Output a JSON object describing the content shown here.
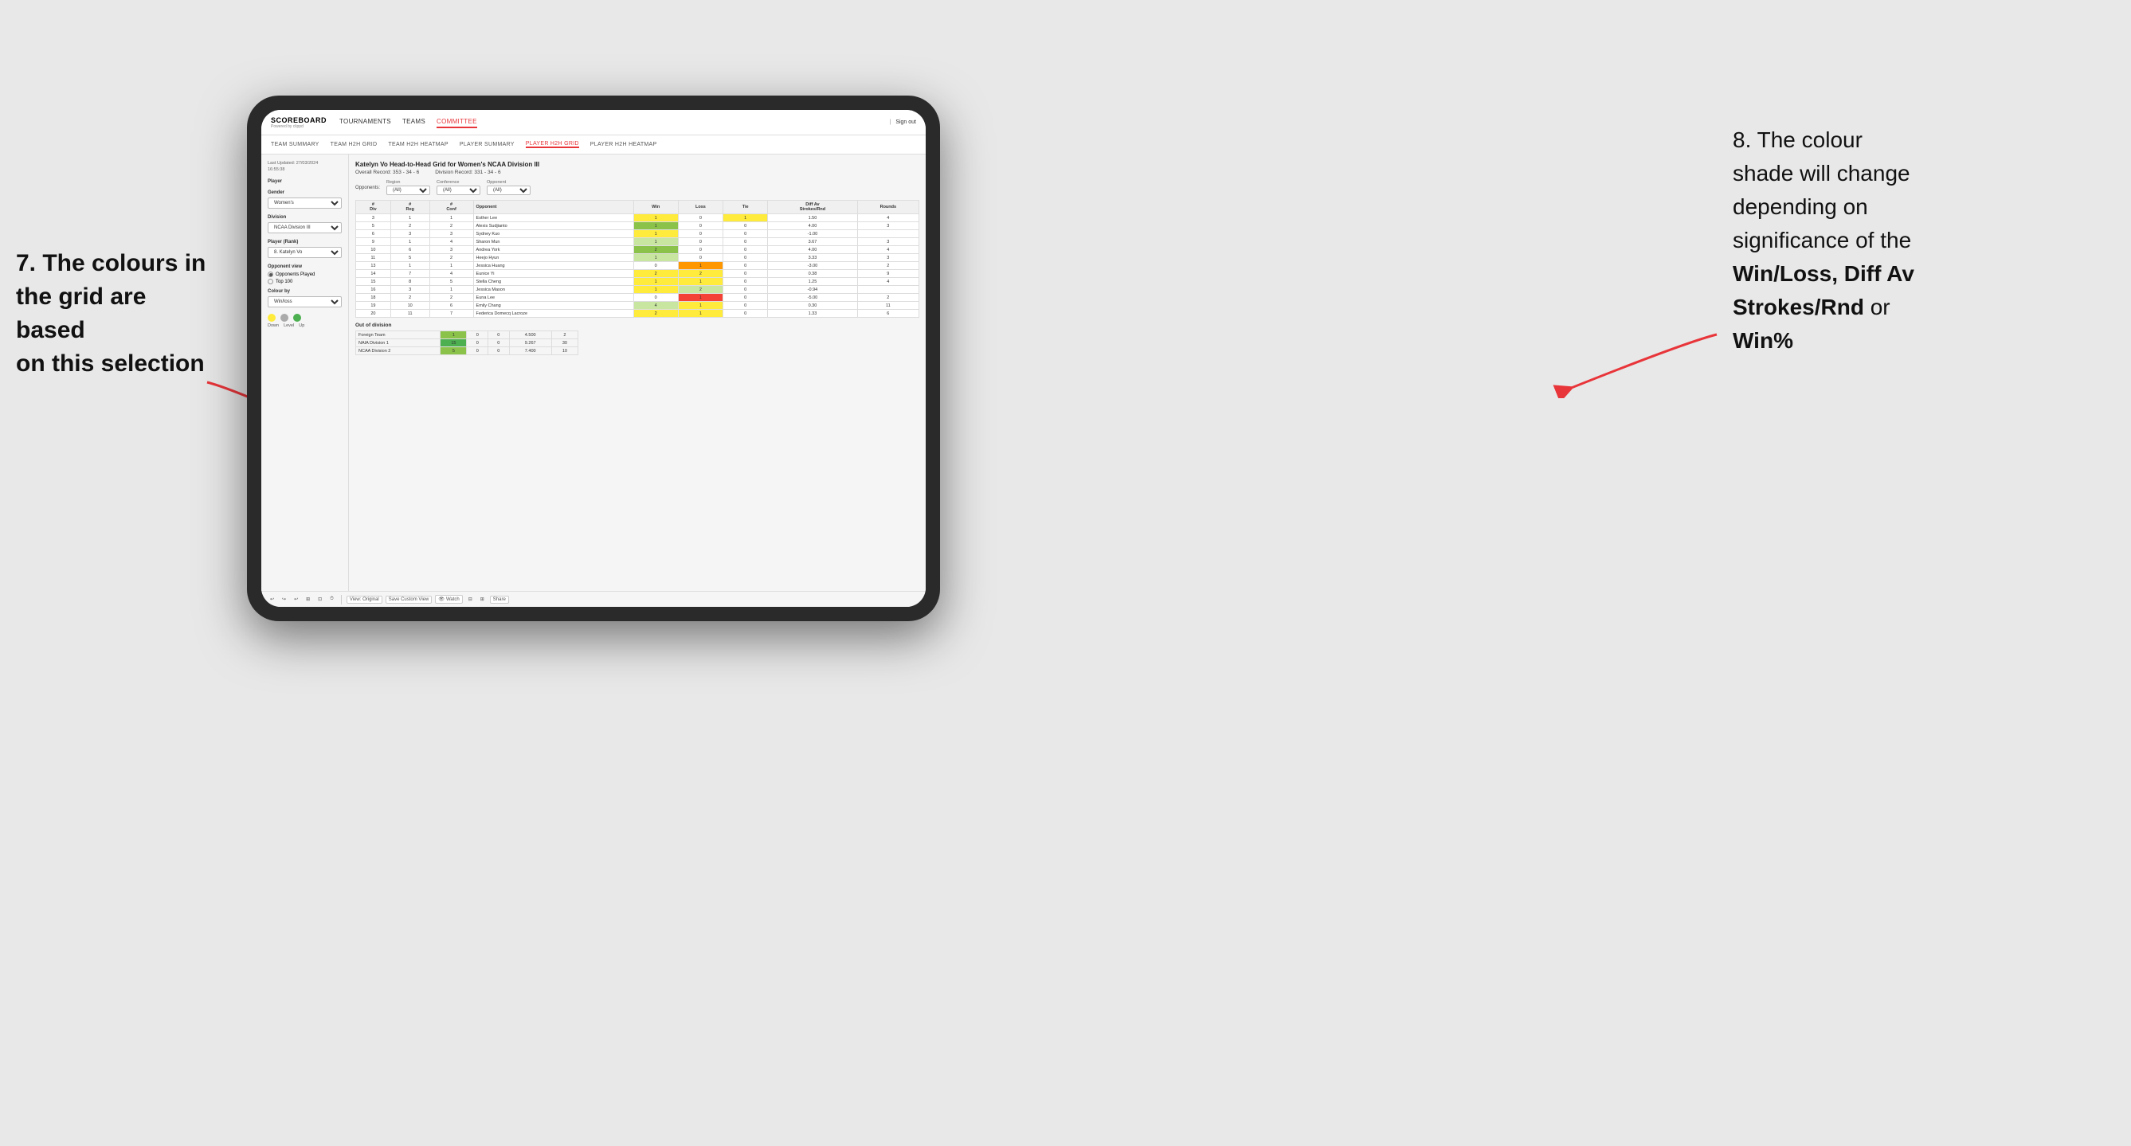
{
  "app": {
    "logo": "SCOREBOARD",
    "logo_sub": "Powered by clippd",
    "nav": {
      "items": [
        {
          "label": "TOURNAMENTS",
          "active": false
        },
        {
          "label": "TEAMS",
          "active": false
        },
        {
          "label": "COMMITTEE",
          "active": true
        }
      ],
      "right": [
        {
          "label": "Sign out"
        }
      ]
    },
    "sub_nav": {
      "items": [
        {
          "label": "TEAM SUMMARY",
          "active": false
        },
        {
          "label": "TEAM H2H GRID",
          "active": false
        },
        {
          "label": "TEAM H2H HEATMAP",
          "active": false
        },
        {
          "label": "PLAYER SUMMARY",
          "active": false
        },
        {
          "label": "PLAYER H2H GRID",
          "active": true
        },
        {
          "label": "PLAYER H2H HEATMAP",
          "active": false
        }
      ]
    }
  },
  "sidebar": {
    "timestamp": "Last Updated: 27/03/2024\n16:55:38",
    "player_section": "Player",
    "gender_label": "Gender",
    "gender_value": "Women's",
    "division_label": "Division",
    "division_value": "NCAA Division III",
    "player_rank_label": "Player (Rank)",
    "player_rank_value": "8. Katelyn Vo",
    "opponent_view_label": "Opponent view",
    "opponents_played": "Opponents Played",
    "top_100": "Top 100",
    "colour_by_label": "Colour by",
    "colour_by_value": "Win/loss",
    "legend_down": "Down",
    "legend_level": "Level",
    "legend_up": "Up"
  },
  "grid": {
    "title": "Katelyn Vo Head-to-Head Grid for Women's NCAA Division III",
    "overall_record_label": "Overall Record:",
    "overall_record": "353 - 34 - 6",
    "division_record_label": "Division Record:",
    "division_record": "331 - 34 - 6",
    "filters": {
      "region_label": "Region",
      "region_value": "(All)",
      "conference_label": "Conference",
      "conference_value": "(All)",
      "opponent_label": "Opponent",
      "opponent_value": "(All)",
      "opponents_label": "Opponents:"
    },
    "table_headers": [
      "#\nDiv",
      "#\nReg",
      "#\nConf",
      "Opponent",
      "Win",
      "Loss",
      "Tie",
      "Diff Av\nStrokes/Rnd",
      "Rounds"
    ],
    "rows": [
      {
        "div": "3",
        "reg": "1",
        "conf": "1",
        "opponent": "Esther Lee",
        "win": "1",
        "loss": "0",
        "tie": "1",
        "diff": "1.50",
        "rounds": "4",
        "win_color": "yellow",
        "loss_color": "",
        "tie_color": "yellow"
      },
      {
        "div": "5",
        "reg": "2",
        "conf": "2",
        "opponent": "Alexis Sudjianto",
        "win": "1",
        "loss": "0",
        "tie": "0",
        "diff": "4.00",
        "rounds": "3",
        "win_color": "green_med",
        "loss_color": "",
        "tie_color": ""
      },
      {
        "div": "6",
        "reg": "3",
        "conf": "3",
        "opponent": "Sydney Kuo",
        "win": "1",
        "loss": "0",
        "tie": "0",
        "diff": "-1.00",
        "rounds": "",
        "win_color": "yellow",
        "loss_color": "",
        "tie_color": ""
      },
      {
        "div": "9",
        "reg": "1",
        "conf": "4",
        "opponent": "Sharon Mun",
        "win": "1",
        "loss": "0",
        "tie": "0",
        "diff": "3.67",
        "rounds": "3",
        "win_color": "green_light",
        "loss_color": "",
        "tie_color": ""
      },
      {
        "div": "10",
        "reg": "6",
        "conf": "3",
        "opponent": "Andrea York",
        "win": "2",
        "loss": "0",
        "tie": "0",
        "diff": "4.00",
        "rounds": "4",
        "win_color": "green_med",
        "loss_color": "",
        "tie_color": ""
      },
      {
        "div": "11",
        "reg": "5",
        "conf": "2",
        "opponent": "Heejo Hyun",
        "win": "1",
        "loss": "0",
        "tie": "0",
        "diff": "3.33",
        "rounds": "3",
        "win_color": "green_light",
        "loss_color": "",
        "tie_color": ""
      },
      {
        "div": "13",
        "reg": "1",
        "conf": "1",
        "opponent": "Jessica Huang",
        "win": "0",
        "loss": "1",
        "tie": "0",
        "diff": "-3.00",
        "rounds": "2",
        "win_color": "",
        "loss_color": "orange",
        "tie_color": ""
      },
      {
        "div": "14",
        "reg": "7",
        "conf": "4",
        "opponent": "Eunice Yi",
        "win": "2",
        "loss": "2",
        "tie": "0",
        "diff": "0.38",
        "rounds": "9",
        "win_color": "yellow",
        "loss_color": "yellow",
        "tie_color": ""
      },
      {
        "div": "15",
        "reg": "8",
        "conf": "5",
        "opponent": "Stella Cheng",
        "win": "1",
        "loss": "1",
        "tie": "0",
        "diff": "1.25",
        "rounds": "4",
        "win_color": "yellow",
        "loss_color": "yellow",
        "tie_color": ""
      },
      {
        "div": "16",
        "reg": "3",
        "conf": "1",
        "opponent": "Jessica Mason",
        "win": "1",
        "loss": "2",
        "tie": "0",
        "diff": "-0.94",
        "rounds": "",
        "win_color": "yellow",
        "loss_color": "green_light",
        "tie_color": ""
      },
      {
        "div": "18",
        "reg": "2",
        "conf": "2",
        "opponent": "Euna Lee",
        "win": "0",
        "loss": "1",
        "tie": "0",
        "diff": "-5.00",
        "rounds": "2",
        "win_color": "",
        "loss_color": "red",
        "tie_color": ""
      },
      {
        "div": "19",
        "reg": "10",
        "conf": "6",
        "opponent": "Emily Chang",
        "win": "4",
        "loss": "1",
        "tie": "0",
        "diff": "0.30",
        "rounds": "11",
        "win_color": "green_light",
        "loss_color": "yellow",
        "tie_color": ""
      },
      {
        "div": "20",
        "reg": "11",
        "conf": "7",
        "opponent": "Federica Domecq Lacroze",
        "win": "2",
        "loss": "1",
        "tie": "0",
        "diff": "1.33",
        "rounds": "6",
        "win_color": "yellow",
        "loss_color": "yellow",
        "tie_color": ""
      }
    ],
    "out_of_division_label": "Out of division",
    "out_of_division_rows": [
      {
        "opponent": "Foreign Team",
        "win": "1",
        "loss": "0",
        "tie": "0",
        "diff": "4.500",
        "rounds": "2",
        "win_color": "green_med"
      },
      {
        "opponent": "NAIA Division 1",
        "win": "15",
        "loss": "0",
        "tie": "0",
        "diff": "9.267",
        "rounds": "30",
        "win_color": "green_dark"
      },
      {
        "opponent": "NCAA Division 2",
        "win": "5",
        "loss": "0",
        "tie": "0",
        "diff": "7.400",
        "rounds": "10",
        "win_color": "green_med"
      }
    ]
  },
  "toolbar": {
    "view_original": "View: Original",
    "save_custom_view": "Save Custom View",
    "watch": "Watch",
    "share": "Share"
  },
  "annotations": {
    "left_text": "7. The colours in\nthe grid are based\non this selection",
    "right_line1": "8. The colour\nshade will change\ndepending on\nsignificance of the",
    "right_bold": "Win/Loss, Diff Av\nStrokes/Rnd",
    "right_line2": "or",
    "right_bold2": "Win%"
  }
}
